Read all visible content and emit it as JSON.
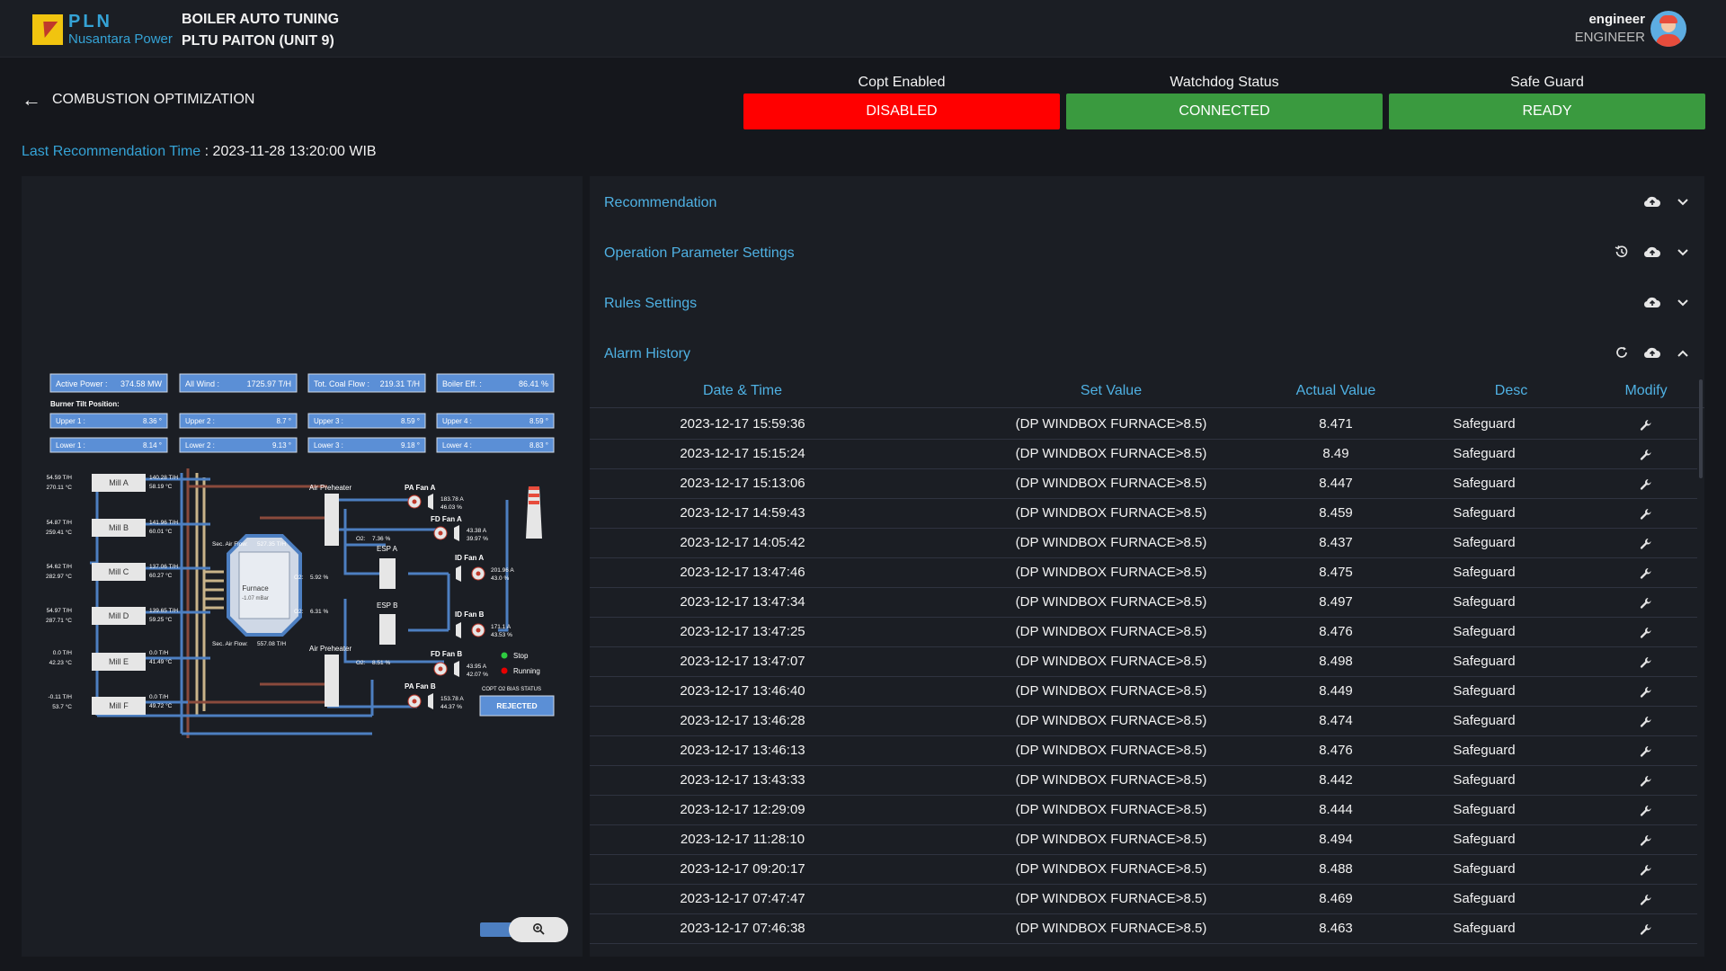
{
  "header": {
    "logo_name": "PLN",
    "logo_sub": "Nusantara Power",
    "title_line1": "BOILER AUTO TUNING",
    "title_line2": "PLTU PAITON (UNIT 9)",
    "user_name": "engineer",
    "user_role": "ENGINEER"
  },
  "page": {
    "back_label": "COMBUSTION OPTIMIZATION",
    "last_rec_label": "Last Recommendation Time",
    "last_rec_value": " : 2023-11-28 13:20:00 WIB"
  },
  "status": [
    {
      "label": "Copt Enabled",
      "value": "DISABLED",
      "color": "#ff0000"
    },
    {
      "label": "Watchdog Status",
      "value": "CONNECTED",
      "color": "#3a9a3f"
    },
    {
      "label": "Safe Guard",
      "value": "READY",
      "color": "#3a9a3f"
    }
  ],
  "diagram": {
    "kpis": [
      {
        "label": "Active Power :",
        "value": "374.58 MW"
      },
      {
        "label": "All Wind :",
        "value": "1725.97 T/H"
      },
      {
        "label": "Tot. Coal Flow :",
        "value": "219.31 T/H"
      },
      {
        "label": "Boiler Eff. :",
        "value": "86.41 %"
      }
    ],
    "burner_title": "Burner Tilt Position:",
    "upper": [
      {
        "label": "Upper 1 :",
        "value": "8.36 °"
      },
      {
        "label": "Upper 2 :",
        "value": "8.7 °"
      },
      {
        "label": "Upper 3 :",
        "value": "8.59 °"
      },
      {
        "label": "Upper 4 :",
        "value": "8.59 °"
      }
    ],
    "lower": [
      {
        "label": "Lower 1 :",
        "value": "8.14 °"
      },
      {
        "label": "Lower 2 :",
        "value": "9.13 °"
      },
      {
        "label": "Lower 3 :",
        "value": "9.18 °"
      },
      {
        "label": "Lower 4 :",
        "value": "8.83 °"
      }
    ],
    "mills": [
      {
        "name": "Mill A",
        "left1": "54.59 T/H",
        "left2": "270.11 °C",
        "right1": "140.28 T/H",
        "right2": "58.19 °C"
      },
      {
        "name": "Mill B",
        "left1": "54.87 T/H",
        "left2": "259.41 °C",
        "right1": "141.96 T/H",
        "right2": "60.01 °C"
      },
      {
        "name": "Mill C",
        "left1": "54.62 T/H",
        "left2": "282.97 °C",
        "right1": "137.06 T/H",
        "right2": "60.27 °C"
      },
      {
        "name": "Mill D",
        "left1": "54.97 T/H",
        "left2": "287.71 °C",
        "right1": "139.65 T/H",
        "right2": "59.25 °C"
      },
      {
        "name": "Mill E",
        "left1": "0.0 T/H",
        "left2": "42.23 °C",
        "right1": "0.0 T/H",
        "right2": "41.49 °C"
      },
      {
        "name": "Mill F",
        "left1": "-0.11 T/H",
        "left2": "53.7 °C",
        "right1": "0.0 T/H",
        "right2": "49.72 °C"
      }
    ],
    "furnace": "Furnace",
    "furnace_val": "-1.07 mBar",
    "sec_air_top": "Sec. Air Flow:",
    "sec_air_top_val": "527.35 T/H",
    "sec_air_bottom": "Sec. Air Flow:",
    "sec_air_bottom_val": "557.08 T/H",
    "o2_a": "O2:",
    "o2_a_val": "5.92 %",
    "o2_b": "O2:",
    "o2_b_val": "6.31 %",
    "o2_top": "O2:",
    "o2_top_val": "7.36 %",
    "o2_bot": "O2:",
    "o2_bot_val": "8.51 %",
    "air_preheater_top": "Air Preheater",
    "air_preheater_bottom": "Air Preheater",
    "esp_a": "ESP A",
    "esp_b": "ESP B",
    "pa_fan_a": "PA Fan A",
    "pa_fan_a_v1": "183.78 A",
    "pa_fan_a_v2": "46.03 %",
    "fd_fan_a": "FD Fan A",
    "fd_fan_a_v1": "43.38 A",
    "fd_fan_a_v2": "39.97 %",
    "id_fan_a": "ID Fan A",
    "id_fan_a_v1": "201.96 A",
    "id_fan_a_v2": "43.0 %",
    "id_fan_b": "ID Fan B",
    "id_fan_b_v1": "171.1 A",
    "id_fan_b_v2": "43.53 %",
    "fd_fan_b": "FD Fan B",
    "fd_fan_b_v1": "43.95 A",
    "fd_fan_b_v2": "42.07 %",
    "pa_fan_b": "PA Fan B",
    "pa_fan_b_v1": "153.78 A",
    "pa_fan_b_v2": "44.37 %",
    "legend_stop": "Stop",
    "legend_running": "Running",
    "bias_title": "COPT O2 BIAS STATUS",
    "bias_value": "REJECTED"
  },
  "accordion": [
    {
      "title": "Recommendation"
    },
    {
      "title": "Operation Parameter Settings"
    },
    {
      "title": "Rules Settings"
    },
    {
      "title": "Alarm History"
    }
  ],
  "alarm_table": {
    "columns": [
      "Date & Time",
      "Set Value",
      "Actual Value",
      "Desc",
      "Modify"
    ],
    "rows": [
      [
        "2023-12-17 15:59:36",
        "(DP WINDBOX FURNACE>8.5)",
        "8.471",
        "Safeguard"
      ],
      [
        "2023-12-17 15:15:24",
        "(DP WINDBOX FURNACE>8.5)",
        "8.49",
        "Safeguard"
      ],
      [
        "2023-12-17 15:13:06",
        "(DP WINDBOX FURNACE>8.5)",
        "8.447",
        "Safeguard"
      ],
      [
        "2023-12-17 14:59:43",
        "(DP WINDBOX FURNACE>8.5)",
        "8.459",
        "Safeguard"
      ],
      [
        "2023-12-17 14:05:42",
        "(DP WINDBOX FURNACE>8.5)",
        "8.437",
        "Safeguard"
      ],
      [
        "2023-12-17 13:47:46",
        "(DP WINDBOX FURNACE>8.5)",
        "8.475",
        "Safeguard"
      ],
      [
        "2023-12-17 13:47:34",
        "(DP WINDBOX FURNACE>8.5)",
        "8.497",
        "Safeguard"
      ],
      [
        "2023-12-17 13:47:25",
        "(DP WINDBOX FURNACE>8.5)",
        "8.476",
        "Safeguard"
      ],
      [
        "2023-12-17 13:47:07",
        "(DP WINDBOX FURNACE>8.5)",
        "8.498",
        "Safeguard"
      ],
      [
        "2023-12-17 13:46:40",
        "(DP WINDBOX FURNACE>8.5)",
        "8.449",
        "Safeguard"
      ],
      [
        "2023-12-17 13:46:28",
        "(DP WINDBOX FURNACE>8.5)",
        "8.474",
        "Safeguard"
      ],
      [
        "2023-12-17 13:46:13",
        "(DP WINDBOX FURNACE>8.5)",
        "8.476",
        "Safeguard"
      ],
      [
        "2023-12-17 13:43:33",
        "(DP WINDBOX FURNACE>8.5)",
        "8.442",
        "Safeguard"
      ],
      [
        "2023-12-17 12:29:09",
        "(DP WINDBOX FURNACE>8.5)",
        "8.444",
        "Safeguard"
      ],
      [
        "2023-12-17 11:28:10",
        "(DP WINDBOX FURNACE>8.5)",
        "8.494",
        "Safeguard"
      ],
      [
        "2023-12-17 09:20:17",
        "(DP WINDBOX FURNACE>8.5)",
        "8.488",
        "Safeguard"
      ],
      [
        "2023-12-17 07:47:47",
        "(DP WINDBOX FURNACE>8.5)",
        "8.469",
        "Safeguard"
      ],
      [
        "2023-12-17 07:46:38",
        "(DP WINDBOX FURNACE>8.5)",
        "8.463",
        "Safeguard"
      ]
    ]
  },
  "icons": {
    "cloud": "cloud-upload-icon",
    "chevron_down": "chevron-down-icon",
    "chevron_up": "chevron-up-icon",
    "history": "history-icon",
    "refresh": "refresh-icon",
    "wrench": "wrench-icon",
    "zoom": "zoom-in-icon",
    "back": "arrow-left-icon"
  }
}
